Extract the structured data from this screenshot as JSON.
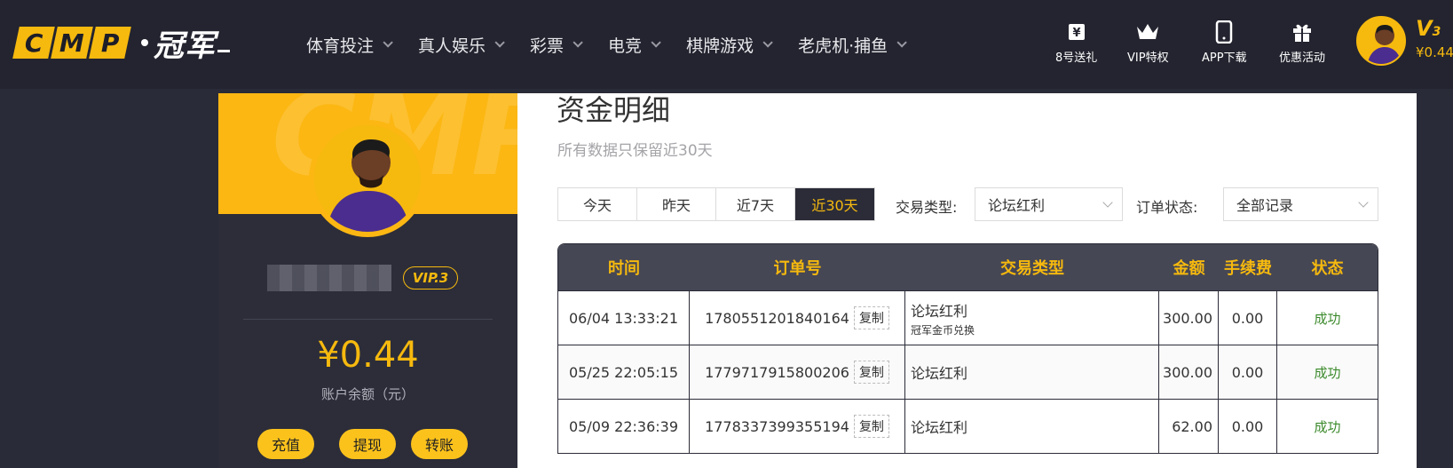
{
  "header": {
    "logo_text": "CMP",
    "logo_cn": "冠军",
    "nav": [
      {
        "label": "体育投注"
      },
      {
        "label": "真人娱乐"
      },
      {
        "label": "彩票"
      },
      {
        "label": "电竞"
      },
      {
        "label": "棋牌游戏"
      },
      {
        "label": "老虎机·捕鱼"
      }
    ],
    "quick_links": [
      {
        "label": "8号送礼",
        "icon": "yen-ticket-icon"
      },
      {
        "label": "VIP特权",
        "icon": "crown-icon"
      },
      {
        "label": "APP下载",
        "icon": "phone-icon"
      },
      {
        "label": "优惠活动",
        "icon": "gift-icon"
      }
    ],
    "vip_level": "V",
    "vip_level_num": "3",
    "balance": "¥0.44"
  },
  "profile": {
    "vip_badge": "VIP.3",
    "balance": "¥0.44",
    "balance_label": "账户余额（元）",
    "buttons": {
      "deposit": "充值",
      "withdraw": "提现",
      "transfer": "转账"
    }
  },
  "main": {
    "title": "资金明细",
    "subtitle": "所有数据只保留近30天",
    "ranges": [
      "今天",
      "昨天",
      "近7天",
      "近30天"
    ],
    "active_range": "近30天",
    "filters": {
      "type_label": "交易类型:",
      "type_value": "论坛红利",
      "status_label": "订单状态:",
      "status_value": "全部记录"
    },
    "table": {
      "headers": [
        "时间",
        "订单号",
        "交易类型",
        "金额",
        "手续费",
        "状态"
      ],
      "copy_label": "复制",
      "rows": [
        {
          "time": "06/04 13:33:21",
          "order": "1780551201840164",
          "type": "论坛红利",
          "note": "冠军金币兑换",
          "amount": "300.00",
          "fee": "0.00",
          "status": "成功"
        },
        {
          "time": "05/25 22:05:15",
          "order": "1779717915800206",
          "type": "论坛红利",
          "note": "",
          "amount": "300.00",
          "fee": "0.00",
          "status": "成功"
        },
        {
          "time": "05/09 22:36:39",
          "order": "1778337399355194",
          "type": "论坛红利",
          "note": "",
          "amount": "62.00",
          "fee": "0.00",
          "status": "成功"
        }
      ]
    }
  },
  "colors": {
    "accent": "#f6b90e",
    "topbar": "#23242f",
    "success": "#3b8a2b"
  }
}
